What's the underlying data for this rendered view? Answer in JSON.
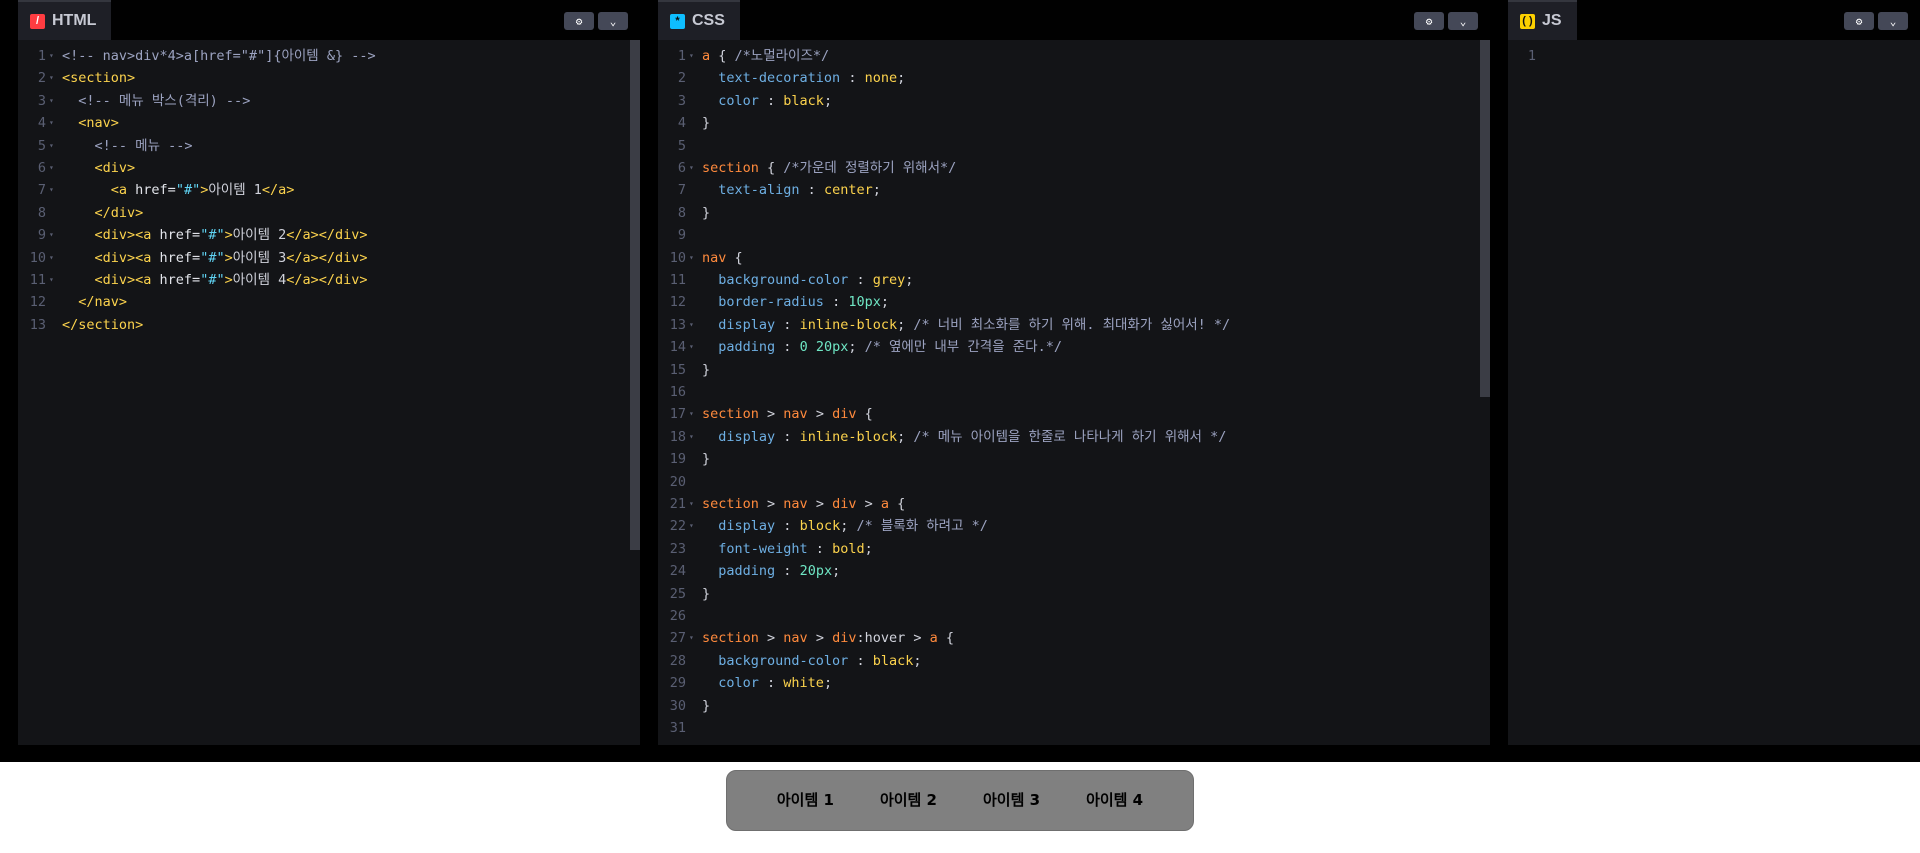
{
  "panels": {
    "html": {
      "tab_label": "HTML",
      "icon_glyph": "/",
      "lines": [
        {
          "n": "1",
          "f": "▾",
          "t": [
            [
              "cmt",
              "<!-- nav>div*4>a[href=\"#\"]{아이템 &} -->"
            ]
          ]
        },
        {
          "n": "2",
          "f": "▾",
          "t": [
            [
              "tag",
              "<section>"
            ]
          ]
        },
        {
          "n": "3",
          "f": "▾",
          "t": [
            [
              "pun",
              "  "
            ],
            [
              "cmt",
              "<!-- 메뉴 박스(격리) -->"
            ]
          ]
        },
        {
          "n": "4",
          "f": "▾",
          "t": [
            [
              "pun",
              "  "
            ],
            [
              "tag",
              "<nav>"
            ]
          ]
        },
        {
          "n": "5",
          "f": "▾",
          "t": [
            [
              "pun",
              "    "
            ],
            [
              "cmt",
              "<!-- 메뉴 -->"
            ]
          ]
        },
        {
          "n": "6",
          "f": "▾",
          "t": [
            [
              "pun",
              "    "
            ],
            [
              "tag",
              "<div>"
            ]
          ]
        },
        {
          "n": "7",
          "f": "▾",
          "t": [
            [
              "pun",
              "      "
            ],
            [
              "tag",
              "<a"
            ],
            [
              "attr",
              " href="
            ],
            [
              "str",
              "\"#\""
            ],
            [
              "tag",
              ">"
            ],
            [
              "pun",
              "아이템 1"
            ],
            [
              "tag",
              "</a>"
            ]
          ]
        },
        {
          "n": "8",
          "f": "",
          "t": [
            [
              "pun",
              "    "
            ],
            [
              "tag",
              "</div>"
            ]
          ]
        },
        {
          "n": "9",
          "f": "▾",
          "t": [
            [
              "pun",
              "    "
            ],
            [
              "tag",
              "<div><a"
            ],
            [
              "attr",
              " href="
            ],
            [
              "str",
              "\"#\""
            ],
            [
              "tag",
              ">"
            ],
            [
              "pun",
              "아이템 2"
            ],
            [
              "tag",
              "</a></div>"
            ]
          ]
        },
        {
          "n": "10",
          "f": "▾",
          "t": [
            [
              "pun",
              "    "
            ],
            [
              "tag",
              "<div><a"
            ],
            [
              "attr",
              " href="
            ],
            [
              "str",
              "\"#\""
            ],
            [
              "tag",
              ">"
            ],
            [
              "pun",
              "아이템 3"
            ],
            [
              "tag",
              "</a></div>"
            ]
          ]
        },
        {
          "n": "11",
          "f": "▾",
          "t": [
            [
              "pun",
              "    "
            ],
            [
              "tag",
              "<div><a"
            ],
            [
              "attr",
              " href="
            ],
            [
              "str",
              "\"#\""
            ],
            [
              "tag",
              ">"
            ],
            [
              "pun",
              "아이템 4"
            ],
            [
              "tag",
              "</a></div>"
            ]
          ]
        },
        {
          "n": "12",
          "f": "",
          "t": [
            [
              "pun",
              "  "
            ],
            [
              "tag",
              "</nav>"
            ]
          ]
        },
        {
          "n": "13",
          "f": "",
          "t": [
            [
              "tag",
              "</section>"
            ]
          ]
        }
      ]
    },
    "css": {
      "tab_label": "CSS",
      "icon_glyph": "*",
      "lines": [
        {
          "n": "1",
          "f": "▾",
          "t": [
            [
              "sel",
              "a"
            ],
            [
              "pun",
              " { "
            ],
            [
              "cmt",
              "/*노멀라이즈*/"
            ]
          ]
        },
        {
          "n": "2",
          "f": "",
          "t": [
            [
              "pun",
              "  "
            ],
            [
              "prop",
              "text-decoration"
            ],
            [
              "pun",
              " : "
            ],
            [
              "val",
              "none"
            ],
            [
              "pun",
              ";"
            ]
          ]
        },
        {
          "n": "3",
          "f": "",
          "t": [
            [
              "pun",
              "  "
            ],
            [
              "prop",
              "color"
            ],
            [
              "pun",
              " : "
            ],
            [
              "val",
              "black"
            ],
            [
              "pun",
              ";"
            ]
          ]
        },
        {
          "n": "4",
          "f": "",
          "t": [
            [
              "pun",
              "}"
            ]
          ]
        },
        {
          "n": "5",
          "f": "",
          "t": []
        },
        {
          "n": "6",
          "f": "▾",
          "t": [
            [
              "sel",
              "section"
            ],
            [
              "pun",
              " { "
            ],
            [
              "cmt",
              "/*가운데 정렬하기 위해서*/"
            ]
          ]
        },
        {
          "n": "7",
          "f": "",
          "t": [
            [
              "pun",
              "  "
            ],
            [
              "prop",
              "text-align"
            ],
            [
              "pun",
              " : "
            ],
            [
              "val",
              "center"
            ],
            [
              "pun",
              ";"
            ]
          ]
        },
        {
          "n": "8",
          "f": "",
          "t": [
            [
              "pun",
              "}"
            ]
          ]
        },
        {
          "n": "9",
          "f": "",
          "t": []
        },
        {
          "n": "10",
          "f": "▾",
          "t": [
            [
              "sel",
              "nav"
            ],
            [
              "pun",
              " {"
            ]
          ]
        },
        {
          "n": "11",
          "f": "",
          "t": [
            [
              "pun",
              "  "
            ],
            [
              "prop",
              "background-color"
            ],
            [
              "pun",
              " : "
            ],
            [
              "val",
              "grey"
            ],
            [
              "pun",
              ";"
            ]
          ]
        },
        {
          "n": "12",
          "f": "",
          "t": [
            [
              "pun",
              "  "
            ],
            [
              "prop",
              "border-radius"
            ],
            [
              "pun",
              " : "
            ],
            [
              "num",
              "10px"
            ],
            [
              "pun",
              ";"
            ]
          ]
        },
        {
          "n": "13",
          "f": "▾",
          "t": [
            [
              "pun",
              "  "
            ],
            [
              "prop",
              "display"
            ],
            [
              "pun",
              " : "
            ],
            [
              "val",
              "inline-block"
            ],
            [
              "pun",
              "; "
            ],
            [
              "cmt",
              "/* 너비 최소화를 하기 위해. 최대화가 싫어서! */"
            ]
          ]
        },
        {
          "n": "14",
          "f": "▾",
          "t": [
            [
              "pun",
              "  "
            ],
            [
              "prop",
              "padding"
            ],
            [
              "pun",
              " : "
            ],
            [
              "num",
              "0 20px"
            ],
            [
              "pun",
              "; "
            ],
            [
              "cmt",
              "/* 옆에만 내부 간격을 준다.*/"
            ]
          ]
        },
        {
          "n": "15",
          "f": "",
          "t": [
            [
              "pun",
              "}"
            ]
          ]
        },
        {
          "n": "16",
          "f": "",
          "t": []
        },
        {
          "n": "17",
          "f": "▾",
          "t": [
            [
              "sel",
              "section"
            ],
            [
              "pun",
              " > "
            ],
            [
              "sel",
              "nav"
            ],
            [
              "pun",
              " > "
            ],
            [
              "sel",
              "div"
            ],
            [
              "pun",
              " {"
            ]
          ]
        },
        {
          "n": "18",
          "f": "▾",
          "t": [
            [
              "pun",
              "  "
            ],
            [
              "prop",
              "display"
            ],
            [
              "pun",
              " : "
            ],
            [
              "val",
              "inline-block"
            ],
            [
              "pun",
              "; "
            ],
            [
              "cmt",
              "/* 메뉴 아이템을 한줄로 나타나게 하기 위해서 */"
            ]
          ]
        },
        {
          "n": "19",
          "f": "",
          "t": [
            [
              "pun",
              "}"
            ]
          ]
        },
        {
          "n": "20",
          "f": "",
          "t": []
        },
        {
          "n": "21",
          "f": "▾",
          "t": [
            [
              "sel",
              "section"
            ],
            [
              "pun",
              " > "
            ],
            [
              "sel",
              "nav"
            ],
            [
              "pun",
              " > "
            ],
            [
              "sel",
              "div"
            ],
            [
              "pun",
              " > "
            ],
            [
              "sel",
              "a"
            ],
            [
              "pun",
              " {"
            ]
          ]
        },
        {
          "n": "22",
          "f": "▾",
          "t": [
            [
              "pun",
              "  "
            ],
            [
              "prop",
              "display"
            ],
            [
              "pun",
              " : "
            ],
            [
              "val",
              "block"
            ],
            [
              "pun",
              "; "
            ],
            [
              "cmt",
              "/* 블록화 하려고 */"
            ]
          ]
        },
        {
          "n": "23",
          "f": "",
          "t": [
            [
              "pun",
              "  "
            ],
            [
              "prop",
              "font-weight"
            ],
            [
              "pun",
              " : "
            ],
            [
              "val",
              "bold"
            ],
            [
              "pun",
              ";"
            ]
          ]
        },
        {
          "n": "24",
          "f": "",
          "t": [
            [
              "pun",
              "  "
            ],
            [
              "prop",
              "padding"
            ],
            [
              "pun",
              " : "
            ],
            [
              "num",
              "20px"
            ],
            [
              "pun",
              ";"
            ]
          ]
        },
        {
          "n": "25",
          "f": "",
          "t": [
            [
              "pun",
              "}"
            ]
          ]
        },
        {
          "n": "26",
          "f": "",
          "t": []
        },
        {
          "n": "27",
          "f": "▾",
          "t": [
            [
              "sel",
              "section"
            ],
            [
              "pun",
              " > "
            ],
            [
              "sel",
              "nav"
            ],
            [
              "pun",
              " > "
            ],
            [
              "sel",
              "div"
            ],
            [
              "pun",
              ":hover > "
            ],
            [
              "sel",
              "a"
            ],
            [
              "pun",
              " {"
            ]
          ]
        },
        {
          "n": "28",
          "f": "",
          "t": [
            [
              "pun",
              "  "
            ],
            [
              "prop",
              "background-color"
            ],
            [
              "pun",
              " : "
            ],
            [
              "val",
              "black"
            ],
            [
              "pun",
              ";"
            ]
          ]
        },
        {
          "n": "29",
          "f": "",
          "t": [
            [
              "pun",
              "  "
            ],
            [
              "prop",
              "color"
            ],
            [
              "pun",
              " : "
            ],
            [
              "val",
              "white"
            ],
            [
              "pun",
              ";"
            ]
          ]
        },
        {
          "n": "30",
          "f": "",
          "t": [
            [
              "pun",
              "}"
            ]
          ]
        },
        {
          "n": "31",
          "f": "",
          "t": []
        }
      ]
    },
    "js": {
      "tab_label": "JS",
      "icon_glyph": "( )",
      "lines": [
        {
          "n": "1",
          "f": "",
          "t": []
        }
      ]
    }
  },
  "settings_icon": "gear-icon",
  "collapse_icon": "chevron-down-icon",
  "preview": {
    "items": [
      "아이템 1",
      "아이템 2",
      "아이템 3",
      "아이템 4"
    ]
  }
}
